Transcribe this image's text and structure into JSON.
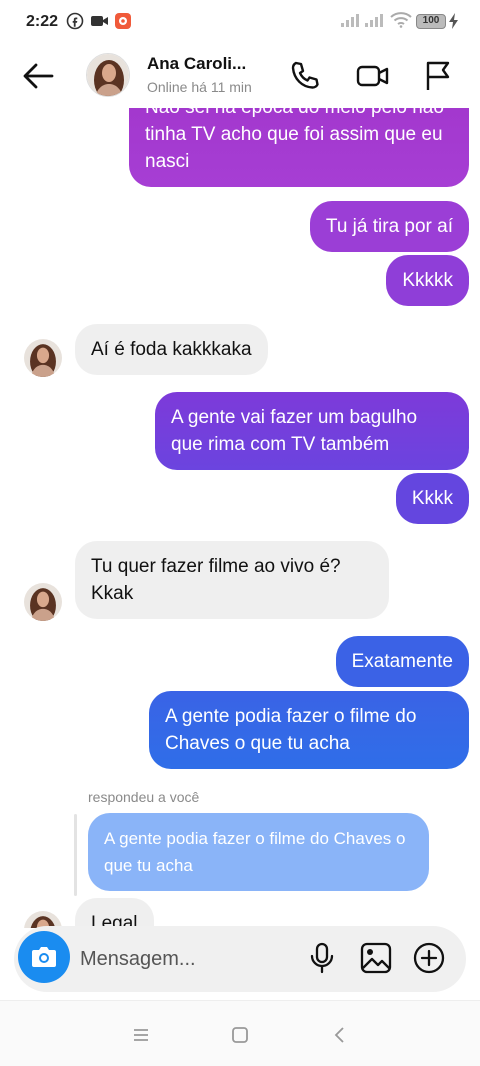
{
  "status_bar": {
    "time": "2:22",
    "battery": "100"
  },
  "header": {
    "contact_name": "Ana Caroli...",
    "contact_status": "Online há 11 min"
  },
  "messages": [
    {
      "dir": "out",
      "text": "Não sei na época do meio pelo não tinha TV acho que foi assim que eu nasci"
    },
    {
      "dir": "out",
      "text": "Tu já tira por aí"
    },
    {
      "dir": "out",
      "text": "Kkkkk"
    },
    {
      "dir": "in",
      "text": "Aí é foda kakkkaka"
    },
    {
      "dir": "out",
      "text": "A gente vai fazer um bagulho que rima com TV também"
    },
    {
      "dir": "out",
      "text": "Kkkk"
    },
    {
      "dir": "in",
      "text": "Tu quer fazer filme ao vivo é? Kkak"
    },
    {
      "dir": "out",
      "text": "Exatamente"
    },
    {
      "dir": "out",
      "text": "A gente podia fazer o filme do Chaves o que tu acha"
    },
    {
      "dir": "in",
      "text": "Legal"
    }
  ],
  "reply": {
    "label": "respondeu a você",
    "quoted_text": "A gente podia fazer o filme do Chaves o que tu acha"
  },
  "composer": {
    "placeholder": "Mensagem..."
  },
  "colors": {
    "bubble_purple": "#a43ad2",
    "bubble_violet": "#7a3de0",
    "bubble_blue": "#2f6fe8",
    "incoming_bg": "#efefef",
    "camera_blue": "#1a8cf0"
  },
  "icons": {
    "back": "arrow-left-icon",
    "call": "phone-icon",
    "video": "video-camera-icon",
    "flag": "flag-icon",
    "camera": "camera-icon",
    "mic": "microphone-icon",
    "gallery": "image-icon",
    "plus": "plus-circle-icon"
  }
}
